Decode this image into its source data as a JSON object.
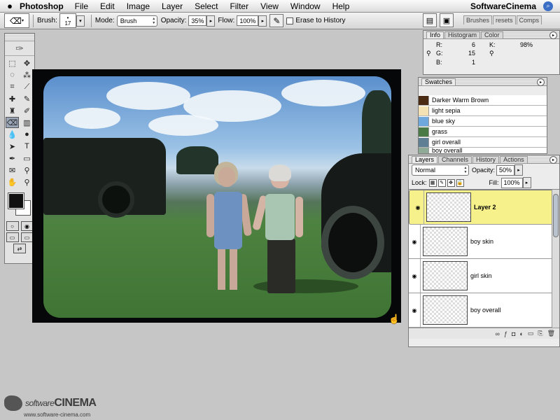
{
  "menubar": {
    "app_name": "Photoshop",
    "items": [
      "File",
      "Edit",
      "Image",
      "Layer",
      "Select",
      "Filter",
      "View",
      "Window",
      "Help"
    ],
    "right_label": "SoftwareCinema"
  },
  "options_bar": {
    "brush_label": "Brush:",
    "brush_size": "17",
    "mode_label": "Mode:",
    "mode_value": "Brush",
    "opacity_label": "Opacity:",
    "opacity_value": "35%",
    "flow_label": "Flow:",
    "flow_value": "100%",
    "erase_history_label": "Erase to History",
    "well_tabs": [
      "Brushes",
      "resets",
      "Comps"
    ]
  },
  "info_panel": {
    "tabs": [
      "Info",
      "Histogram",
      "Color"
    ],
    "r_label": "R:",
    "r_value": "6",
    "g_label": "G:",
    "g_value": "15",
    "b_label": "B:",
    "b_value": "1",
    "k_label": "K:",
    "k_value": "98%"
  },
  "swatches_panel": {
    "tab": "Swatches",
    "items": [
      {
        "name": "Darker Warm Brown",
        "color": "#4a2a12"
      },
      {
        "name": "light sepia",
        "color": "#f5e2b4"
      },
      {
        "name": "blue sky",
        "color": "#6fa8dc"
      },
      {
        "name": "grass",
        "color": "#4a7a45"
      },
      {
        "name": "girl overall",
        "color": "#5f7f95"
      },
      {
        "name": "boy overall",
        "color": "#8faa97"
      }
    ]
  },
  "layers_panel": {
    "tabs": [
      "Layers",
      "Channels",
      "History",
      "Actions"
    ],
    "blend_mode": "Normal",
    "opacity_label": "Opacity:",
    "opacity_value": "50%",
    "lock_label": "Lock:",
    "fill_label": "Fill:",
    "fill_value": "100%",
    "layers": [
      {
        "name": "Layer 2",
        "selected": true
      },
      {
        "name": "boy skin",
        "selected": false
      },
      {
        "name": "girl skin",
        "selected": false
      },
      {
        "name": "boy overall",
        "selected": false
      }
    ]
  },
  "watermark": {
    "brand_lower": "software",
    "brand_upper": "CINEMA",
    "url": "www.software-cinema.com"
  },
  "colors": {
    "selected_layer": "#f6f18b",
    "foreground": "#111111",
    "background": "#ffffff"
  }
}
